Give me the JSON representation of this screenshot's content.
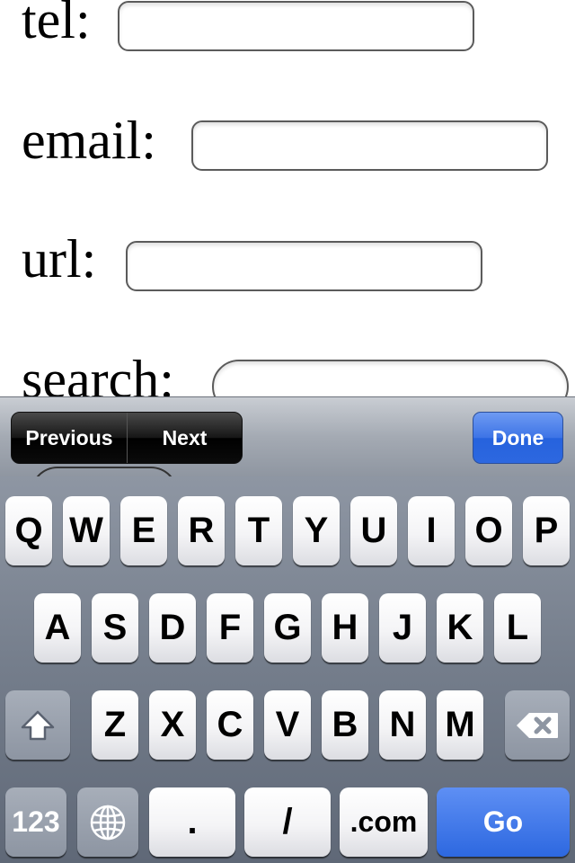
{
  "form": {
    "tel_label": "tel:",
    "email_label": "email:",
    "url_label": "url:",
    "search_label": "search:"
  },
  "assistant": {
    "previous_label": "Previous",
    "next_label": "Next",
    "done_label": "Done"
  },
  "keyboard": {
    "row1": [
      "Q",
      "W",
      "E",
      "R",
      "T",
      "Y",
      "U",
      "I",
      "O",
      "P"
    ],
    "row2": [
      "A",
      "S",
      "D",
      "F",
      "G",
      "H",
      "J",
      "K",
      "L"
    ],
    "row3": [
      "Z",
      "X",
      "C",
      "V",
      "B",
      "N",
      "M"
    ],
    "numbers_label": "123",
    "period_label": ".",
    "slash_label": "/",
    "dotcom_label": ".com",
    "go_label": "Go",
    "shift_icon": "shift-arrow",
    "delete_icon": "delete-backspace",
    "globe_icon": "globe",
    "go_color": "#2d68e0"
  }
}
